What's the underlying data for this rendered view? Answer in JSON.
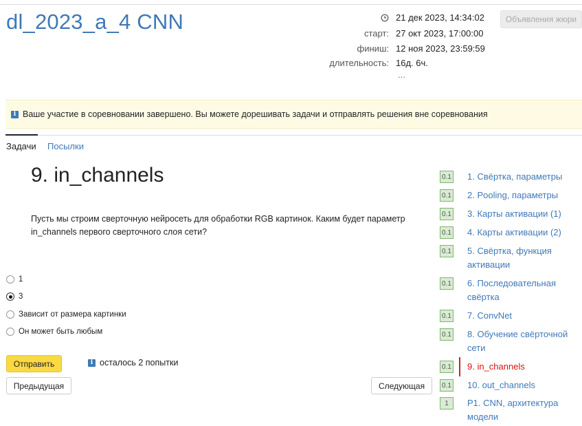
{
  "header": {
    "contest_title": "dl_2023_a_4 CNN",
    "current_time": "21 дек 2023, 14:34:02",
    "start_label": "старт:",
    "start_value": "27 окт 2023, 17:00:00",
    "finish_label": "финиш:",
    "finish_value": "12 ноя 2023, 23:59:59",
    "duration_label": "длительность:",
    "duration_value": "16д. 6ч.",
    "more": "...",
    "jury_button": "Объявления жюри"
  },
  "notice": {
    "text": "Ваше участие в соревновании завершено. Вы можете дорешивать задачи и отправлять решения вне соревнования"
  },
  "tabs": [
    {
      "label": "Задачи",
      "active": true
    },
    {
      "label": "Посылки",
      "active": false
    }
  ],
  "problem": {
    "title": "9. in_channels",
    "statement": "Пусть мы строим сверточную нейросеть для обработки RGB картинок. Каким будет параметр in_channels первого сверточного слоя сети?",
    "options": [
      {
        "label": "1",
        "checked": false
      },
      {
        "label": "3",
        "checked": true
      },
      {
        "label": "Зависит от размера картинки",
        "checked": false
      },
      {
        "label": "Он может быть любым",
        "checked": false
      }
    ],
    "submit_label": "Отправить",
    "attempts_text": "осталось 2 попытки",
    "prev_label": "Предыдущая",
    "next_label": "Следующая"
  },
  "task_list": [
    {
      "score": "0.1",
      "title": "1. Свёртка, параметры"
    },
    {
      "score": "0.1",
      "title": "2. Pooling, параметры"
    },
    {
      "score": "0.1",
      "title": "3. Карты активации (1)"
    },
    {
      "score": "0.1",
      "title": "4. Карты активации (2)"
    },
    {
      "score": "0.1",
      "title": "5. Свёртка, функция активации"
    },
    {
      "score": "0.1",
      "title": "6. Последовательная свёртка"
    },
    {
      "score": "0.1",
      "title": "7. ConvNet"
    },
    {
      "score": "0.1",
      "title": "8. Обучение свёрточной сети"
    },
    {
      "score": "0.1",
      "title": "9. in_channels",
      "active": true
    },
    {
      "score": "0.1",
      "title": "10. out_channels"
    },
    {
      "score": "1",
      "title": "P1. CNN, архитектура модели"
    }
  ],
  "colors": {
    "link": "#3f79b8",
    "active_task": "#dd1111",
    "submit": "#fbd943",
    "badge_bg": "#d9ecd3"
  }
}
